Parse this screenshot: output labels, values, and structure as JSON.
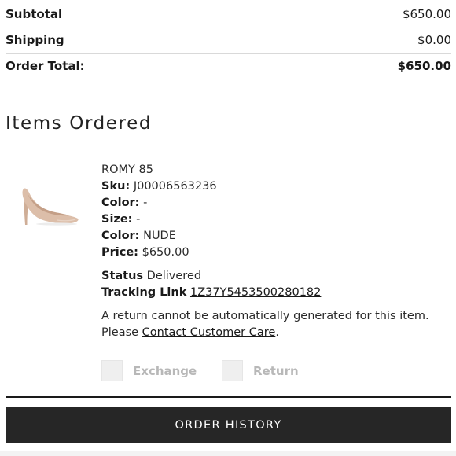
{
  "summary": {
    "subtotal_label": "Subtotal",
    "subtotal_value": "$650.00",
    "shipping_label": "Shipping",
    "shipping_value": "$0.00",
    "total_label": "Order Total:",
    "total_value": "$650.00"
  },
  "items_section": {
    "title": "Items Ordered"
  },
  "item": {
    "name": "ROMY 85",
    "sku_label": "Sku:",
    "sku_value": "J00006563236",
    "color_label": "Color:",
    "color_value": "-",
    "size_label": "Size:",
    "size_value": "-",
    "color2_label": "Color:",
    "color2_value": "NUDE",
    "price_label": "Price:",
    "price_value": "$650.00",
    "status_label": "Status",
    "status_value": "Delivered",
    "tracking_label": "Tracking Link",
    "tracking_value": "1Z37Y5453500280182",
    "return_message_pre": "A return cannot be automatically generated for this item. Please",
    "contact_link": "Contact Customer Care",
    "return_message_post": ".",
    "image_icon": "nude-pump-shoe"
  },
  "options": {
    "exchange_label": "Exchange",
    "return_label": "Return"
  },
  "footer": {
    "order_history_label": "ORDER HISTORY"
  },
  "colors": {
    "button_bg": "#262626",
    "shoe_nude": "#d8b9a3"
  }
}
